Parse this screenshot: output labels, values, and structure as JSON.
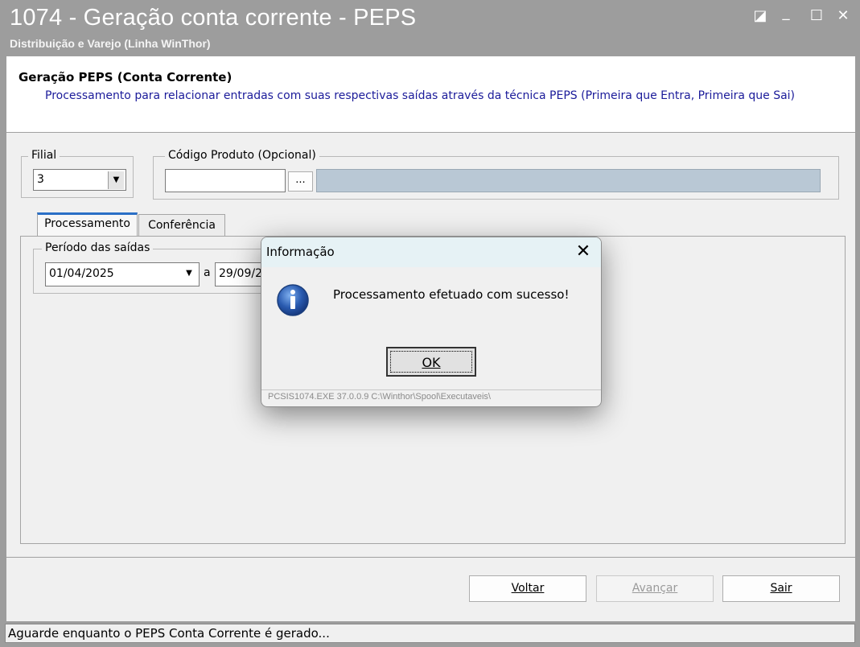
{
  "window": {
    "title": "1074 - Geração conta corrente - PEPS",
    "subtitle": "Distribuição e Varejo (Linha WinThor)",
    "controls": {
      "restore": "◪",
      "minimize": "_",
      "maximize": "☐",
      "close": "✕"
    }
  },
  "header": {
    "title": "Geração PEPS (Conta Corrente)",
    "description": "Processamento para relacionar entradas com suas respectivas saídas através da técnica PEPS (Primeira que Entra, Primeira que Sai)"
  },
  "filial": {
    "label": "Filial",
    "value": "3"
  },
  "produto": {
    "label": "Código Produto (Opcional)",
    "value": "",
    "lookup_label": "..."
  },
  "tabs": [
    {
      "label": "Processamento",
      "active": true
    },
    {
      "label": "Conferência",
      "active": false
    }
  ],
  "periodo": {
    "label": "Período das saídas",
    "from": "01/04/2025",
    "sep": "a",
    "to": "29/09/2"
  },
  "buttons": {
    "voltar": "Voltar",
    "avancar": "Avançar",
    "sair": "Sair"
  },
  "status": {
    "text": "Aguarde enquanto o PEPS Conta Corrente é gerado..."
  },
  "dialog": {
    "title": "Informação",
    "message": "Processamento efetuado com sucesso!",
    "ok_label": "OK",
    "footer": "PCSIS1074.EXE 37.0.0.9 C:\\Winthor\\Spool\\Executaveis\\"
  },
  "colors": {
    "titlebar": "#9d9d9d",
    "header_desc": "#1b1b9a",
    "dialog_title": "#e6f2f5",
    "info_icon": "#2a5bb0"
  }
}
